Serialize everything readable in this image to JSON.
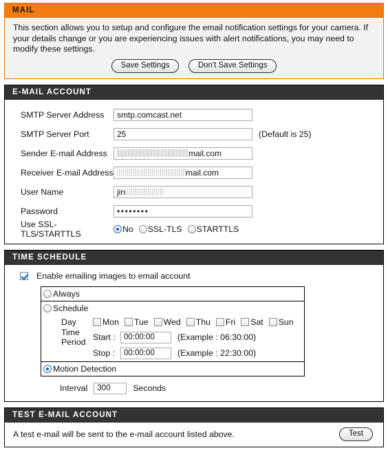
{
  "mail": {
    "title": "MAIL",
    "intro": "This section allows you to setup and configure the email notification settings for your camera. If your details change or you are experiencing issues with alert notifications, you may need to modify these settings.",
    "save_label": "Save Settings",
    "dont_save_label": "Don't Save Settings",
    "accent_color": "#f47b10"
  },
  "email_account": {
    "title": "E-MAIL ACCOUNT",
    "header_color": "#333333",
    "smtp_server_label": "SMTP Server Address",
    "smtp_server_value": "smtp.comcast.net",
    "smtp_port_label": "SMTP Server Port",
    "smtp_port_value": "25",
    "smtp_port_hint": "(Default is 25)",
    "sender_label": "Sender E-mail Address",
    "sender_value_tail": "mail.com",
    "receiver_label": "Receiver E-mail Address",
    "receiver_value_tail": "mail.com",
    "username_label": "User Name",
    "username_value_prefix": "jin",
    "password_label": "Password",
    "password_value": "••••••••",
    "ssl_label": "Use SSL-TLS/STARTTLS",
    "ssl_options": [
      {
        "label": "No",
        "selected": true
      },
      {
        "label": "SSL-TLS",
        "selected": false
      },
      {
        "label": "STARTTLS",
        "selected": false
      }
    ]
  },
  "time_schedule": {
    "title": "TIME SCHEDULE",
    "enable_label": "Enable emailing images to email account",
    "enable_checked": true,
    "always_label": "Always",
    "always_selected": false,
    "schedule_label": "Schedule",
    "schedule_selected": false,
    "day_label": "Day",
    "days": [
      {
        "label": "Mon",
        "checked": false
      },
      {
        "label": "Tue",
        "checked": false
      },
      {
        "label": "Wed",
        "checked": false
      },
      {
        "label": "Thu",
        "checked": false
      },
      {
        "label": "Fri",
        "checked": false
      },
      {
        "label": "Sat",
        "checked": false
      },
      {
        "label": "Sun",
        "checked": false
      }
    ],
    "time_period_label": "Time Period",
    "start_label": "Start :",
    "start_value": "00:00:00",
    "start_hint": "(Example : 06:30:00)",
    "stop_label": "Stop :",
    "stop_value": "00:00:00",
    "stop_hint": "(Example : 22:30:00)",
    "motion_label": "Motion Detection",
    "motion_selected": true,
    "interval_label": "Interval",
    "interval_value": "300",
    "interval_unit": "Seconds"
  },
  "test_account": {
    "title": "TEST E-MAIL ACCOUNT",
    "description": "A test e-mail will be sent to the e-mail account listed above.",
    "test_label": "Test"
  }
}
